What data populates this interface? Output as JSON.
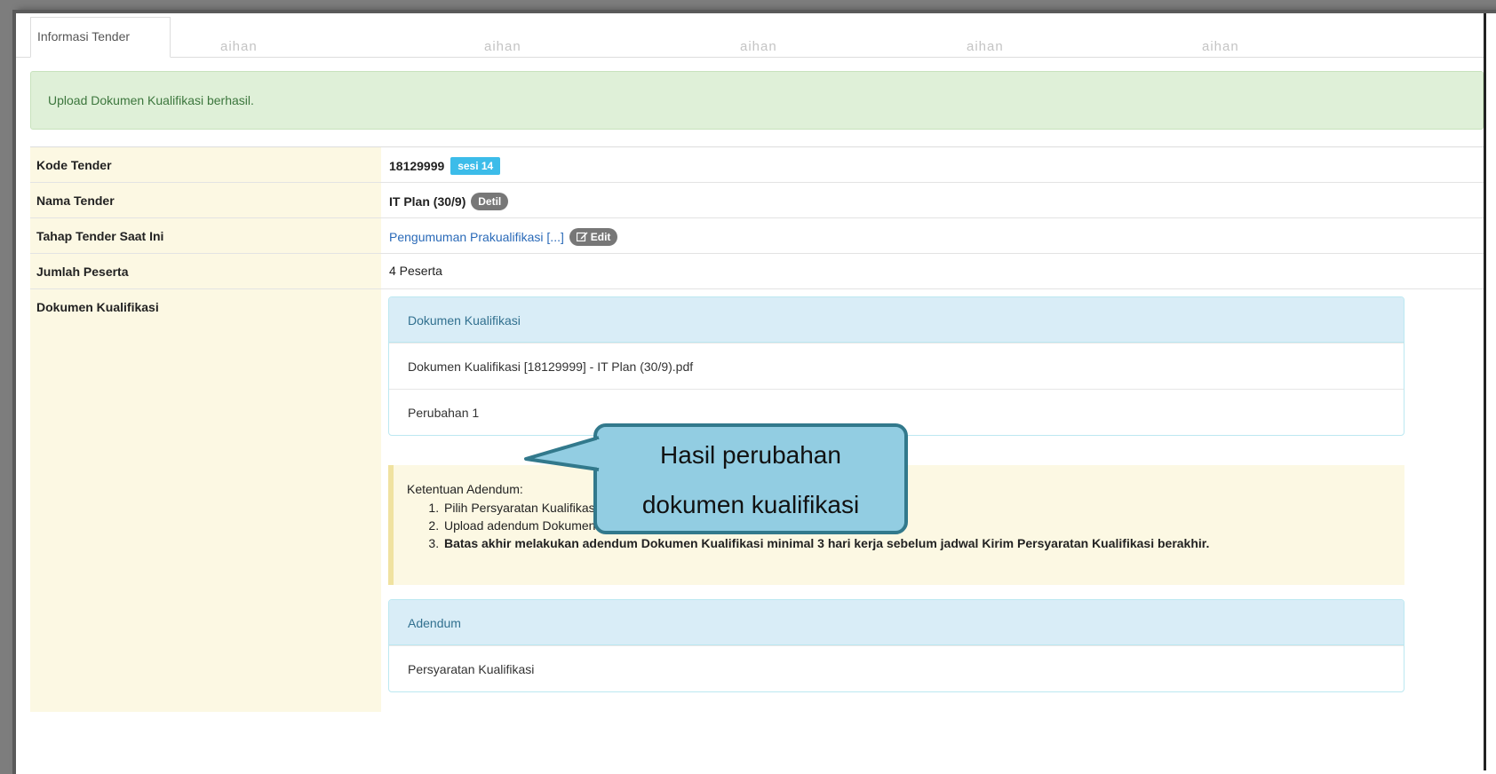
{
  "tabs": [
    {
      "label": "Informasi Tender",
      "active": true
    }
  ],
  "watermark_text": "aihan",
  "alert": {
    "message": "Upload Dokumen Kualifikasi berhasil."
  },
  "info": {
    "kode_label": "Kode Tender",
    "kode_value": "18129999",
    "kode_badge": "sesi 14",
    "nama_label": "Nama Tender",
    "nama_value": "IT Plan (30/9)",
    "nama_badge": "Detil",
    "tahap_label": "Tahap Tender Saat Ini",
    "tahap_value": "Pengumuman Prakualifikasi [...]",
    "tahap_button": "Edit",
    "jumlah_label": "Jumlah Peserta",
    "jumlah_value": "4 Peserta",
    "dokumen_label": "Dokumen Kualifikasi"
  },
  "dokumen_panel": {
    "heading": "Dokumen Kualifikasi",
    "items": [
      "Dokumen Kualifikasi [18129999] - IT Plan (30/9).pdf",
      "Perubahan 1"
    ]
  },
  "ketentuan": {
    "title": "Ketentuan Adendum:",
    "items": [
      "Pilih Persyaratan Kualifikasi jika ada bagian yang diadendum;",
      "Upload adendum Dokumen Kualifikasi yang baru; dan",
      "Batas akhir melakukan adendum Dokumen Kualifikasi minimal 3 hari kerja sebelum jadwal Kirim Persyaratan Kualifikasi berakhir."
    ]
  },
  "adendum_panel": {
    "heading": "Adendum",
    "items": [
      "Persyaratan Kualifikasi"
    ]
  },
  "callout": {
    "line1": "Hasil perubahan",
    "line2": "dokumen kualifikasi"
  },
  "colors": {
    "alert_bg": "#dff0d8",
    "label_bg": "#fcf8e3",
    "panel_head": "#d9edf7",
    "badge_info": "#3cbce9",
    "callout_bg": "#92cde2",
    "callout_border": "#32798c"
  }
}
